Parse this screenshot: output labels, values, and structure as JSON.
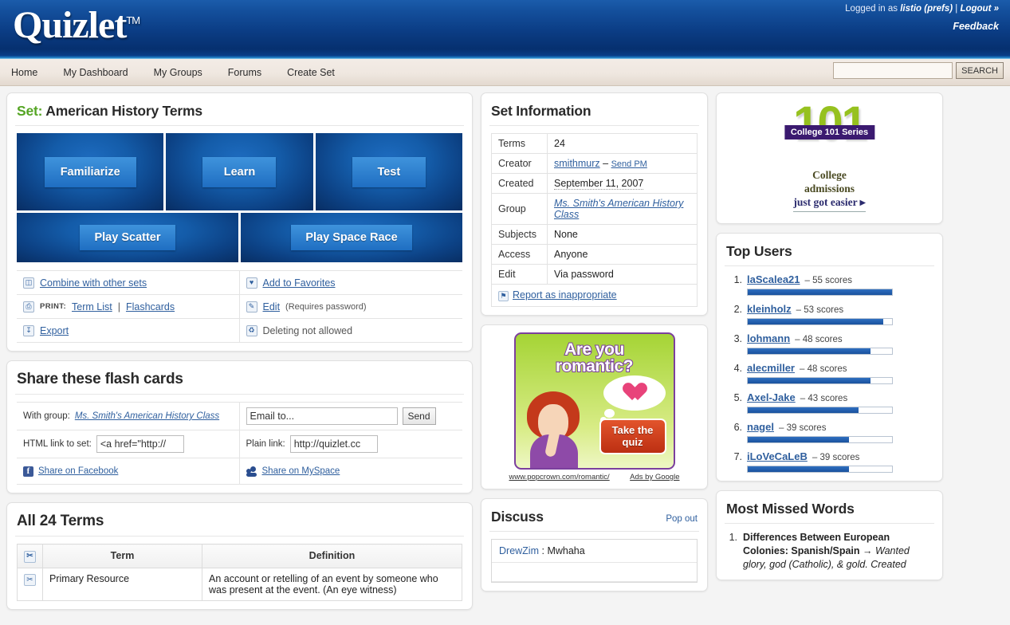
{
  "header": {
    "logo": "Quizlet",
    "logo_tm": "TM",
    "logged_in_prefix": "Logged in as",
    "username": "listio (prefs)",
    "separator": "|",
    "logout": "Logout »",
    "feedback": "Feedback"
  },
  "nav": {
    "items": [
      {
        "label": "Home"
      },
      {
        "label": "My Dashboard"
      },
      {
        "label": "My Groups"
      },
      {
        "label": "Forums"
      },
      {
        "label": "Create Set"
      }
    ],
    "search_value": "",
    "search_placeholder": "",
    "search_button": "SEARCH"
  },
  "set": {
    "label": "Set:",
    "title": "American History Terms",
    "modes": [
      {
        "label": "Familiarize"
      },
      {
        "label": "Learn"
      },
      {
        "label": "Test"
      }
    ],
    "games": [
      {
        "label": "Play Scatter"
      },
      {
        "label": "Play Space Race"
      }
    ],
    "actions": {
      "combine": "Combine with other sets",
      "favorites": "Add to Favorites",
      "print_label": "PRINT:",
      "print_termlist": "Term List",
      "print_sep": "|",
      "print_flashcards": "Flashcards",
      "edit": "Edit",
      "edit_note": "(Requires password)",
      "export": "Export",
      "delete": "Deleting not allowed"
    }
  },
  "share": {
    "title": "Share these flash cards",
    "with_group_label": "With group:",
    "group_name": "Ms. Smith's American History Class",
    "email_value": "Email to...",
    "send_label": "Send",
    "html_link_label": "HTML link to set:",
    "html_link_value": "<a href=\"http://",
    "plain_link_label": "Plain link:",
    "plain_link_value": "http://quizlet.cc",
    "facebook": "Share on Facebook",
    "myspace": "Share on MySpace"
  },
  "terms_panel": {
    "title": "All 24 Terms",
    "columns": [
      "",
      "Term",
      "Definition"
    ],
    "rows": [
      {
        "term": "Primary Resource",
        "definition": "An account or retelling of an event by someone who was present at the event. (An eye witness)"
      }
    ]
  },
  "set_information": {
    "title": "Set Information",
    "rows": [
      {
        "key": "Terms",
        "value": "24",
        "type": "text"
      },
      {
        "key": "Creator",
        "value": "smithmurz",
        "type": "creator",
        "dash": "–",
        "extra": "Send PM"
      },
      {
        "key": "Created",
        "value": "September 11, 2007",
        "type": "dotted"
      },
      {
        "key": "Group",
        "value": "Ms. Smith's American History Class",
        "type": "link-italic"
      },
      {
        "key": "Subjects",
        "value": "None",
        "type": "text"
      },
      {
        "key": "Access",
        "value": "Anyone",
        "type": "text"
      },
      {
        "key": "Edit",
        "value": "Via password",
        "type": "text"
      }
    ],
    "report_label": "Report as inappropriate"
  },
  "ad_romantic": {
    "headline_line1": "Are you",
    "headline_line2": "romantic?",
    "cta_line1": "Take the",
    "cta_line2": "quiz",
    "url": "www.popcrown.com/romantic/",
    "ads_by": "Ads by Google"
  },
  "ad_college": {
    "number": "101",
    "badge": "College 101 Series",
    "line1": "College",
    "line2": "admissions",
    "line3": "just got easier ▸"
  },
  "top_users": {
    "title": "Top Users",
    "score_suffix": "scores",
    "dash": "–",
    "users": [
      {
        "rank": "1.",
        "name": "laScalea21",
        "scores": 55,
        "bar_pct": 100
      },
      {
        "rank": "2.",
        "name": "kleinholz",
        "scores": 53,
        "bar_pct": 94
      },
      {
        "rank": "3.",
        "name": "lohmann",
        "scores": 48,
        "bar_pct": 85
      },
      {
        "rank": "4.",
        "name": "alecmiller",
        "scores": 48,
        "bar_pct": 85
      },
      {
        "rank": "5.",
        "name": "Axel-Jake",
        "scores": 43,
        "bar_pct": 77
      },
      {
        "rank": "6.",
        "name": "nagel",
        "scores": 39,
        "bar_pct": 70
      },
      {
        "rank": "7.",
        "name": "iLoVeCaLeB",
        "scores": 39,
        "bar_pct": 70
      }
    ]
  },
  "most_missed": {
    "title": "Most Missed Words",
    "items": [
      {
        "rank": "1.",
        "bold": "Differences Between European Colonies: Spanish/Spain →",
        "italic": "Wanted glory, god (Catholic), & gold. Created"
      }
    ]
  },
  "discuss": {
    "title": "Discuss",
    "popout": "Pop out",
    "messages": [
      {
        "author": "DrewZim",
        "sep": ":",
        "text": "Mwhaha"
      }
    ]
  },
  "icons": {
    "combine": "combine-sets-icon",
    "heart": "heart-icon",
    "print": "printer-icon",
    "pencil": "pencil-icon",
    "download": "download-icon",
    "trash": "trash-icon",
    "flag": "flag-icon",
    "scissors": "scissors-icon",
    "facebook": "facebook-icon",
    "myspace": "myspace-icon"
  },
  "colors": {
    "header_blue": "#0b3d85",
    "link_blue": "#2f5f9e",
    "set_green": "#55a524",
    "bar_blue": "#19529e"
  }
}
